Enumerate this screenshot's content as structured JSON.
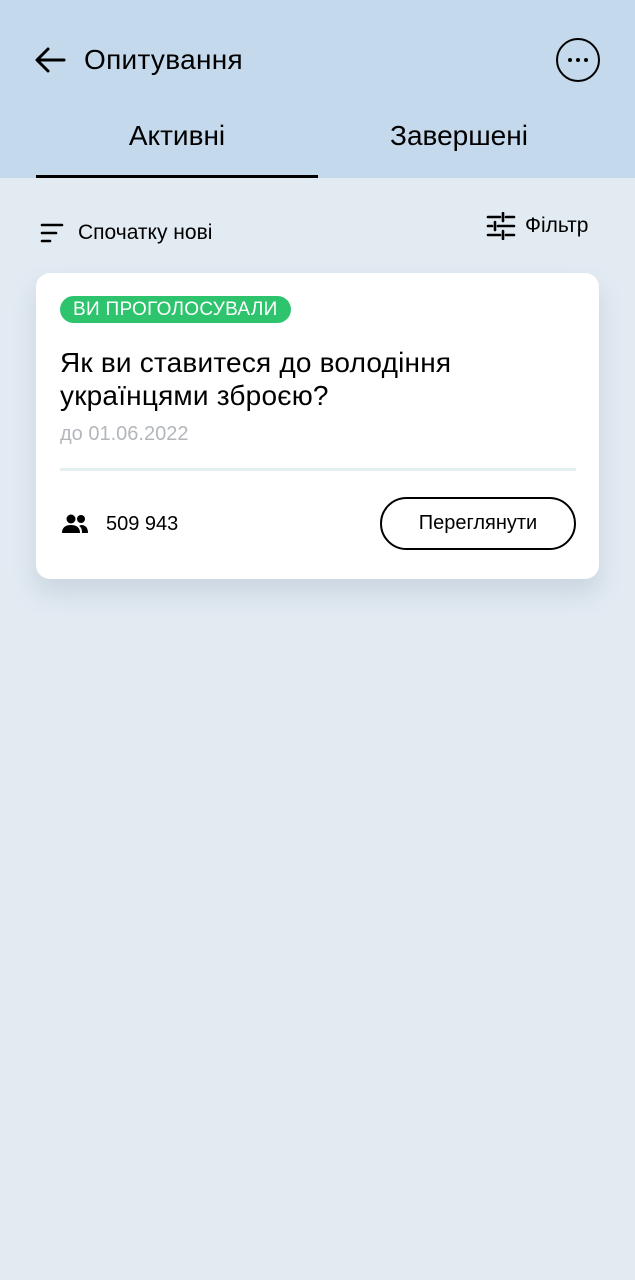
{
  "header": {
    "title": "Опитування",
    "tabs": [
      {
        "label": "Активні",
        "active": true
      },
      {
        "label": "Завершені",
        "active": false
      }
    ]
  },
  "toolbar": {
    "sort_label": "Спочатку нові",
    "filter_label": "Фільтр"
  },
  "polls": [
    {
      "badge": "ВИ ПРОГОЛОСУВАЛИ",
      "question": "Як ви ставитеся до володіння українцями зброєю?",
      "deadline": "до 01.06.2022",
      "voters": "509 943",
      "view_label": "Переглянути"
    }
  ],
  "icons": {
    "back": "arrow-left-icon",
    "more": "more-horizontal-icon",
    "sort": "sort-lines-icon",
    "filter": "sliders-icon",
    "voters": "people-icon"
  },
  "colors": {
    "header_bg": "#c4d9eb",
    "page_bg": "#e2eaf2",
    "badge_bg": "#2ec46e",
    "deadline_text": "#b3b7bb"
  }
}
